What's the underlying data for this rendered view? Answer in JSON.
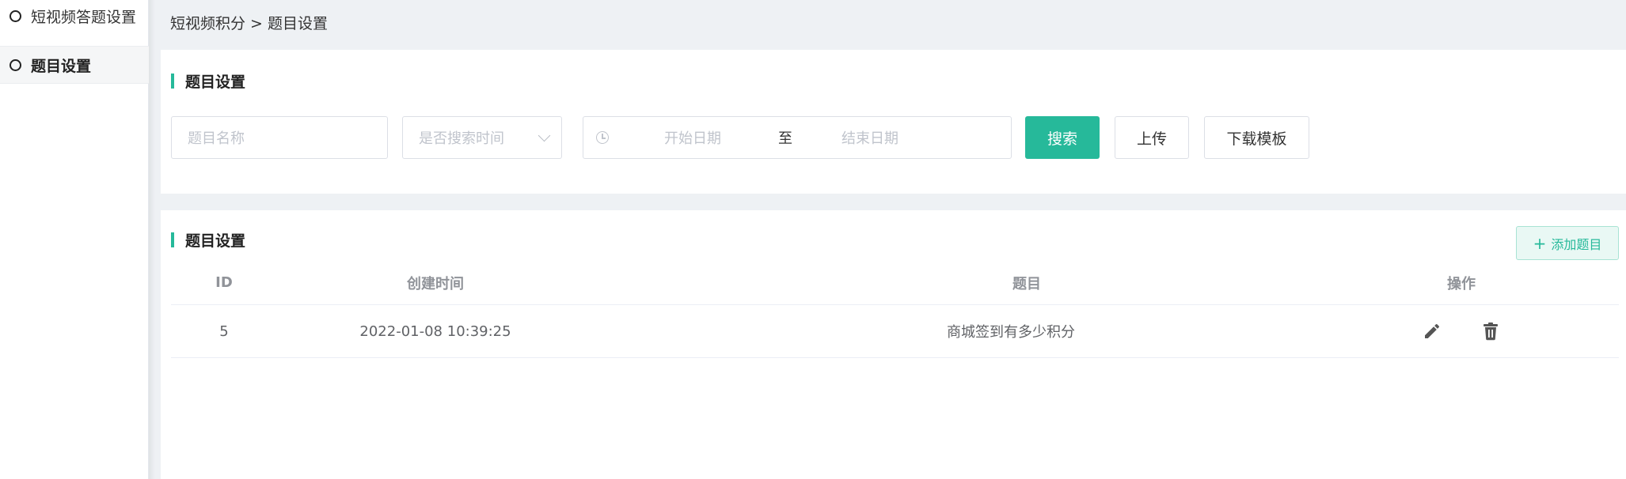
{
  "sidebar": {
    "items": [
      {
        "label": "短视频答题设置"
      },
      {
        "label": "题目设置"
      }
    ]
  },
  "breadcrumb": "短视频积分 > 题目设置",
  "filter_card": {
    "title": "题目设置",
    "name_placeholder": "题目名称",
    "select_placeholder": "是否搜索时间",
    "date_start_placeholder": "开始日期",
    "date_separator": "至",
    "date_end_placeholder": "结束日期",
    "search_label": "搜索",
    "upload_label": "上传",
    "download_label": "下载模板"
  },
  "table_card": {
    "title": "题目设置",
    "add_label": "添加题目",
    "columns": [
      "ID",
      "创建时间",
      "题目",
      "操作"
    ],
    "rows": [
      {
        "id": "5",
        "created": "2022-01-08 10:39:25",
        "question": "商城签到有多少积分"
      }
    ]
  },
  "colors": {
    "accent": "#26b99a",
    "background": "#eef1f4"
  },
  "icons": [
    "clock-icon",
    "chevron-down-icon",
    "plus-icon",
    "edit-icon",
    "delete-icon"
  ]
}
